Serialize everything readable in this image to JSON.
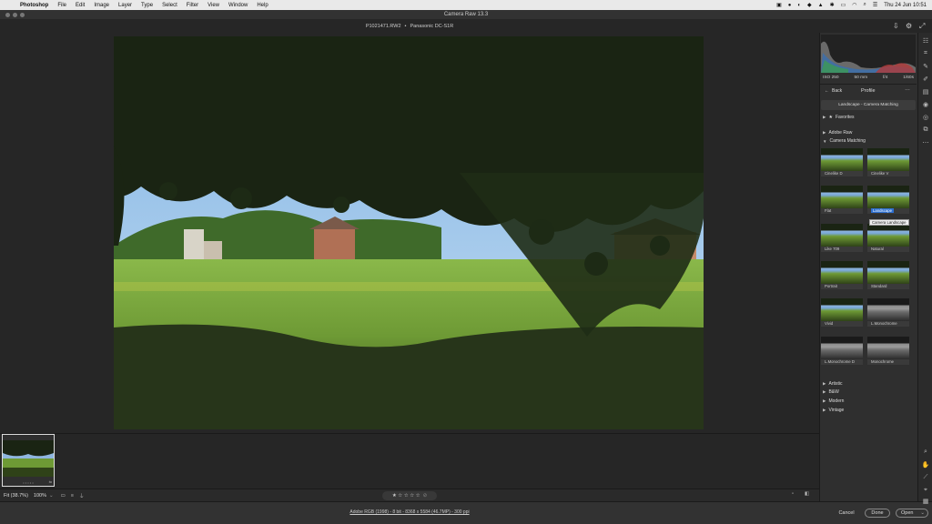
{
  "menubar": {
    "app": "Photoshop",
    "items": [
      "File",
      "Edit",
      "Image",
      "Layer",
      "Type",
      "Select",
      "Filter",
      "View",
      "Window",
      "Help"
    ],
    "clock": "Thu 24 Jun  10:51"
  },
  "window": {
    "title": "Camera Raw 13.3"
  },
  "file": {
    "name": "P1021471.RW2",
    "separator": "•",
    "camera": "Panasonic DC-S1R"
  },
  "exif": {
    "iso": "ISO 250",
    "focal": "50 mm",
    "aperture": "f/4",
    "shutter": "1/60s"
  },
  "profile_panel": {
    "back": "Back",
    "title": "Profile",
    "menu": "…",
    "current": "Landscape - Camera Matching",
    "sections": {
      "favorites": "Favorites",
      "adobe_raw": "Adobe Raw",
      "camera_matching": "Camera Matching",
      "artistic": "Artistic",
      "bw": "B&W",
      "modern": "Modern",
      "vintage": "Vintage"
    },
    "tiles": [
      "Cinelike D",
      "Cinelike V",
      "Flat",
      "Landscape",
      "Like 709",
      "Natural",
      "Portrait",
      "Standard",
      "Vivid",
      "L.Monochrome",
      "L.Monochrome D",
      "Monochrome"
    ],
    "tooltip": "Camera Landscape"
  },
  "bottom": {
    "fit": "Fit (38.7%)",
    "zoom": "100%",
    "rating_stars": "★ ☆ ☆ ☆ ☆",
    "reject": "⊘"
  },
  "status": {
    "info": "Adobe RGB (1998) - 8 bit - 8368 x 5584 (46.7MP) - 300 ppi",
    "cancel": "Cancel",
    "done": "Done",
    "open": "Open"
  },
  "thumb": {
    "dots": "• • • • •"
  }
}
